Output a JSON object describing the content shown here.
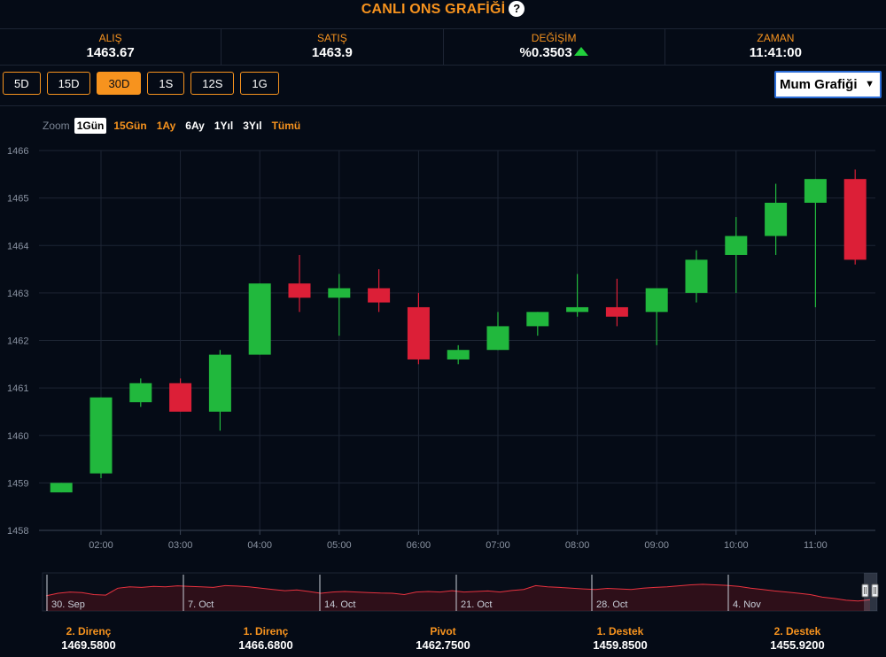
{
  "header": {
    "title": "CANLI ONS GRAFİĞİ",
    "help_icon": "question-circle-icon"
  },
  "stats": [
    {
      "label": "ALIŞ",
      "value": "1463.67"
    },
    {
      "label": "SATIŞ",
      "value": "1463.9"
    },
    {
      "label": "DEĞİŞİM",
      "value": "%0.3503",
      "trend_icon": "up-arrow-icon"
    },
    {
      "label": "ZAMAN",
      "value": "11:41:00"
    }
  ],
  "periods": [
    {
      "label": "5D",
      "active": false
    },
    {
      "label": "15D",
      "active": false
    },
    {
      "label": "30D",
      "active": true
    },
    {
      "label": "1S",
      "active": false
    },
    {
      "label": "12S",
      "active": false
    },
    {
      "label": "1G",
      "active": false
    }
  ],
  "chart_type_select": {
    "value": "Mum Grafiği"
  },
  "zoom": {
    "label": "Zoom",
    "options": [
      {
        "label": "1Gün",
        "state": "active"
      },
      {
        "label": "15Gün",
        "state": "accent"
      },
      {
        "label": "1Ay",
        "state": "accent"
      },
      {
        "label": "6Ay",
        "state": "normal"
      },
      {
        "label": "1Yıl",
        "state": "normal"
      },
      {
        "label": "3Yıl",
        "state": "normal"
      },
      {
        "label": "Tümü",
        "state": "accent"
      }
    ]
  },
  "colors": {
    "accent": "#f7931e",
    "up": "#21b83d",
    "down": "#dc1f37",
    "background": "#050b16"
  },
  "chart_data": {
    "type": "candlestick",
    "x_tick_labels": [
      "02:00",
      "03:00",
      "04:00",
      "05:00",
      "06:00",
      "07:00",
      "08:00",
      "09:00",
      "10:00",
      "11:00"
    ],
    "y_tick_labels": [
      "1458",
      "1459",
      "1460",
      "1461",
      "1462",
      "1463",
      "1464",
      "1465",
      "1466"
    ],
    "ylim": [
      1458,
      1466
    ],
    "grid": true,
    "candles": [
      {
        "time": "01:30",
        "open": 1458.8,
        "high": 1459.0,
        "low": 1458.8,
        "close": 1459.0
      },
      {
        "time": "02:00",
        "open": 1459.2,
        "high": 1460.8,
        "low": 1459.1,
        "close": 1460.8
      },
      {
        "time": "02:30",
        "open": 1460.7,
        "high": 1461.2,
        "low": 1460.6,
        "close": 1461.1
      },
      {
        "time": "03:00",
        "open": 1461.1,
        "high": 1461.2,
        "low": 1460.5,
        "close": 1460.5
      },
      {
        "time": "03:30",
        "open": 1460.5,
        "high": 1461.8,
        "low": 1460.1,
        "close": 1461.7
      },
      {
        "time": "04:00",
        "open": 1461.7,
        "high": 1463.2,
        "low": 1461.7,
        "close": 1463.2
      },
      {
        "time": "04:30",
        "open": 1463.2,
        "high": 1463.8,
        "low": 1462.6,
        "close": 1462.9
      },
      {
        "time": "05:00",
        "open": 1462.9,
        "high": 1463.4,
        "low": 1462.1,
        "close": 1463.1
      },
      {
        "time": "05:30",
        "open": 1463.1,
        "high": 1463.5,
        "low": 1462.6,
        "close": 1462.8
      },
      {
        "time": "06:00",
        "open": 1462.7,
        "high": 1463.0,
        "low": 1461.5,
        "close": 1461.6
      },
      {
        "time": "06:30",
        "open": 1461.6,
        "high": 1461.9,
        "low": 1461.5,
        "close": 1461.8
      },
      {
        "time": "07:00",
        "open": 1461.8,
        "high": 1462.6,
        "low": 1461.8,
        "close": 1462.3
      },
      {
        "time": "07:30",
        "open": 1462.3,
        "high": 1462.6,
        "low": 1462.1,
        "close": 1462.6
      },
      {
        "time": "08:00",
        "open": 1462.6,
        "high": 1463.4,
        "low": 1462.5,
        "close": 1462.7
      },
      {
        "time": "08:30",
        "open": 1462.7,
        "high": 1463.3,
        "low": 1462.3,
        "close": 1462.5
      },
      {
        "time": "09:00",
        "open": 1462.6,
        "high": 1463.1,
        "low": 1461.9,
        "close": 1463.1
      },
      {
        "time": "09:30",
        "open": 1463.0,
        "high": 1463.9,
        "low": 1462.8,
        "close": 1463.7
      },
      {
        "time": "10:00",
        "open": 1463.8,
        "high": 1464.6,
        "low": 1463.0,
        "close": 1464.2
      },
      {
        "time": "10:30",
        "open": 1464.2,
        "high": 1465.3,
        "low": 1463.8,
        "close": 1464.9
      },
      {
        "time": "11:00",
        "open": 1464.9,
        "high": 1465.4,
        "low": 1462.7,
        "close": 1465.4
      },
      {
        "time": "11:30",
        "open": 1465.4,
        "high": 1465.6,
        "low": 1463.6,
        "close": 1463.7
      }
    ],
    "navigator": {
      "labels": [
        "30. Sep",
        "7. Oct",
        "14. Oct",
        "21. Oct",
        "28. Oct",
        "4. Nov"
      ],
      "values": [
        0.45,
        0.55,
        0.6,
        0.58,
        0.5,
        0.48,
        0.75,
        0.8,
        0.78,
        0.82,
        0.8,
        0.84,
        0.82,
        0.8,
        0.78,
        0.85,
        0.83,
        0.8,
        0.75,
        0.7,
        0.65,
        0.68,
        0.62,
        0.55,
        0.6,
        0.62,
        0.6,
        0.58,
        0.56,
        0.55,
        0.5,
        0.6,
        0.62,
        0.6,
        0.65,
        0.6,
        0.62,
        0.64,
        0.6,
        0.66,
        0.7,
        0.85,
        0.8,
        0.78,
        0.75,
        0.72,
        0.7,
        0.74,
        0.72,
        0.7,
        0.75,
        0.78,
        0.8,
        0.84,
        0.88,
        0.9,
        0.88,
        0.86,
        0.82,
        0.75,
        0.7,
        0.64,
        0.6,
        0.55,
        0.5,
        0.4,
        0.35,
        0.28,
        0.25,
        0.3
      ]
    }
  },
  "pivots": [
    {
      "label": "2. Direnç",
      "value": "1469.5800"
    },
    {
      "label": "1. Direnç",
      "value": "1466.6800"
    },
    {
      "label": "Pivot",
      "value": "1462.7500"
    },
    {
      "label": "1. Destek",
      "value": "1459.8500"
    },
    {
      "label": "2. Destek",
      "value": "1455.9200"
    }
  ]
}
